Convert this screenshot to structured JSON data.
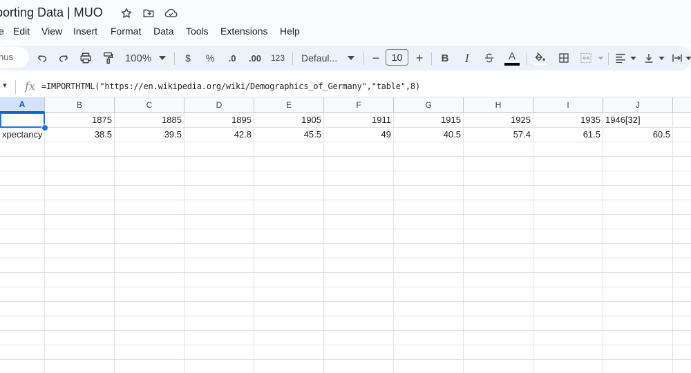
{
  "title": "porting Data | MUO",
  "menu": [
    "e",
    "Edit",
    "View",
    "Insert",
    "Format",
    "Data",
    "Tools",
    "Extensions",
    "Help"
  ],
  "toolbar": {
    "menus_search_label": "nus",
    "zoom": "100%",
    "currency": "$",
    "percent": "%",
    "decrease_decimal": ".0",
    "increase_decimal": ".00",
    "number_format": "123",
    "font": "Defaul...",
    "font_size": "10",
    "minus": "−",
    "plus": "+",
    "bold": "B",
    "italic": "I",
    "text_color": "A"
  },
  "formula": "=IMPORTHTML(\"https://en.wikipedia.org/wiki/Demographics_of_Germany\",\"table\",8)",
  "columns": [
    "A",
    "B",
    "C",
    "D",
    "E",
    "F",
    "G",
    "H",
    "I",
    "J"
  ],
  "rows": [
    [
      "",
      "1875",
      "1885",
      "1895",
      "1905",
      "1911",
      "1915",
      "1925",
      "1935",
      "1946[32]"
    ],
    [
      "xpectancy",
      "38.5",
      "39.5",
      "42.8",
      "45.5",
      "49",
      "40.5",
      "57.4",
      "61.5",
      "60.5"
    ]
  ],
  "colors": {
    "accent": "#1a73e8",
    "header_bg": "#f8f9fa",
    "toolbar_bg": "#edf2fa"
  }
}
